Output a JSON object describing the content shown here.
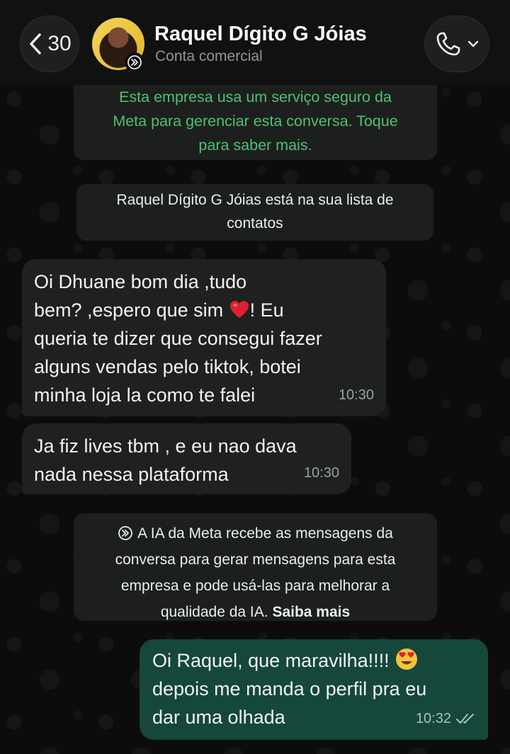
{
  "header": {
    "back_count": "30",
    "contact_name": "Raquel Dígito G Jóias",
    "contact_subtitle": "Conta comercial"
  },
  "system_messages": {
    "meta_notice": [
      "Esta empresa usa um serviço seguro da",
      "Meta para gerenciar esta conversa. Toque",
      "para saber mais."
    ],
    "contact_notice": [
      "Raquel Dígito G Jóias está na sua lista de",
      "contatos"
    ],
    "ai_notice": {
      "line1": "A IA da Meta recebe as mensagens da",
      "line2": "conversa para gerar mensagens para esta",
      "line3": "empresa e pode usá-las para melhorar a",
      "line4_prefix": "qualidade da IA. ",
      "link": "Saiba mais"
    }
  },
  "messages": [
    {
      "direction": "incoming",
      "lines": [
        "Oi Dhuane bom dia ,tudo",
        "bem? ,espero que sim",
        "! Eu",
        "queria te dizer que consegui fazer",
        "alguns vendas pelo tiktok, botei",
        "minha loja la  como te falei"
      ],
      "time": "10:30"
    },
    {
      "direction": "incoming",
      "lines": [
        "Ja fiz lives tbm , e eu nao dava",
        "nada nessa plataforma"
      ],
      "time": "10:30"
    },
    {
      "direction": "outgoing",
      "lines": [
        "Oi Raquel, que maravilha!!!!",
        "depois me manda o perfil pra eu",
        "dar uma olhada"
      ],
      "time": "10:32",
      "status": "read"
    }
  ],
  "colors": {
    "header_bg": "#111111",
    "incoming_bubble": "#1f2020",
    "outgoing_bubble": "#15473b",
    "meta_notice_text": "#4fc06e",
    "read_ticks": "#a9c2bb"
  },
  "icons": [
    "chevron-left-icon",
    "meta-ai-icon",
    "phone-icon",
    "chevron-down-icon",
    "heart-emoji",
    "heart-eyes-emoji",
    "double-check-icon"
  ]
}
